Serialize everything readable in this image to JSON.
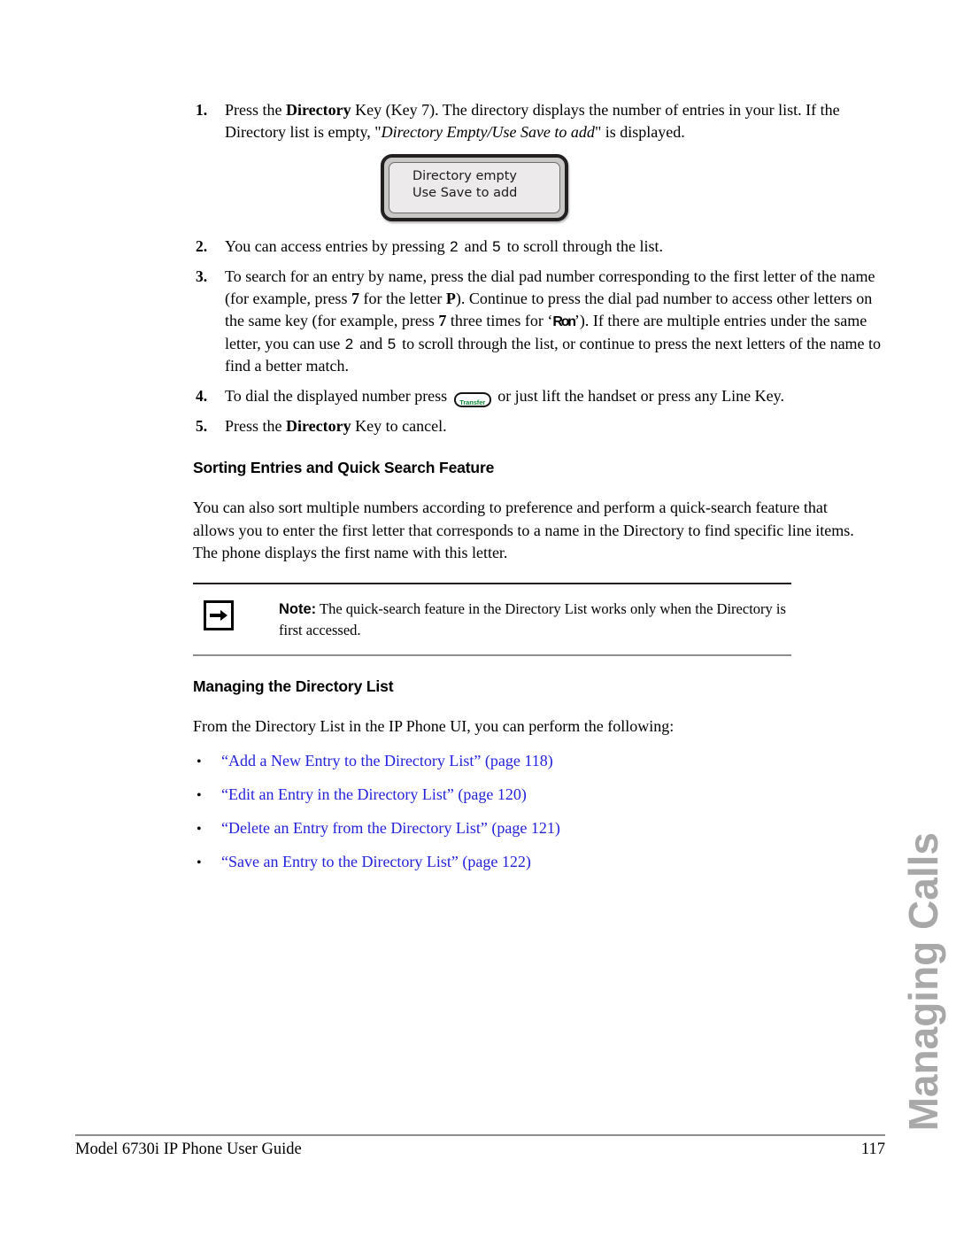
{
  "document": {
    "footer_title": "Model 6730i IP Phone User Guide",
    "page_number": "117",
    "side_tab": "Managing Calls",
    "link_color": "#2222dd",
    "tab_color": "#a8a8a8"
  },
  "steps": [
    {
      "num": "1.",
      "parts": {
        "t1": "Press the ",
        "b1": "Directory",
        "t2": " Key (Key 7). The directory displays the number of entries in your list. If the Directory list is empty, \"",
        "i1": "Directory Empty/Use Save to add",
        "t3": "\" is displayed."
      }
    },
    {
      "num": "2.",
      "parts": {
        "t1": "You can access entries by pressing ",
        "k1": "2",
        "t2": " and ",
        "k2": "5",
        "t3": " to scroll through the list."
      }
    },
    {
      "num": "3.",
      "parts": {
        "t1": "To search for an entry by name, press the dial pad number corresponding to the first letter of the name (for example, press ",
        "b1": "7",
        "t2": " for the letter ",
        "b2": "P",
        "t3": "). Continue to press the dial pad number to access other letters on the same key (for example, press ",
        "b3": "7",
        "t4": " three times for ‘",
        "g1": "Ron",
        "t5": "’). If there are multiple entries under the same letter, you can use ",
        "k1": "2",
        "t6": " and ",
        "k2": "5",
        "t7": " to scroll through the list, or continue to press the next letters of the name to find a better match."
      }
    },
    {
      "num": "4.",
      "parts": {
        "t1": "To dial the displayed number press ",
        "key_label": "Transfer",
        "t2": " or just lift the handset or press any Line Key."
      }
    },
    {
      "num": "5.",
      "parts": {
        "t1": "Press the ",
        "b1": "Directory",
        "t2": " Key to cancel."
      }
    }
  ],
  "lcd": {
    "line1": "Directory empty",
    "line2": "Use Save to add"
  },
  "sections": {
    "sorting": {
      "heading": "Sorting Entries and Quick Search Feature",
      "paragraph": "You can also sort multiple numbers according to preference and perform a quick-search feature that allows you to enter the first letter that corresponds to a name in the Directory to find specific line items. The phone displays the first name with this letter."
    },
    "managing": {
      "heading": "Managing the Directory List",
      "paragraph": "From the Directory List in the IP Phone UI, you can perform the following:"
    }
  },
  "note": {
    "label": "Note:",
    "text": " The quick-search feature in the Directory List works only when the Directory is first accessed.",
    "icon": "arrow-right-icon"
  },
  "xrefs": [
    {
      "bullet": "•",
      "title": "“Add a New Entry to the Directory List”",
      "page": " (page 118)"
    },
    {
      "bullet": "•",
      "title": "“Edit an Entry in the Directory List”",
      "page": " (page 120)"
    },
    {
      "bullet": "•",
      "title": "“Delete an Entry from the Directory List”",
      "page": " (page 121)"
    },
    {
      "bullet": "•",
      "title": "“Save an Entry to the Directory List”",
      "page": " (page 122)"
    }
  ]
}
